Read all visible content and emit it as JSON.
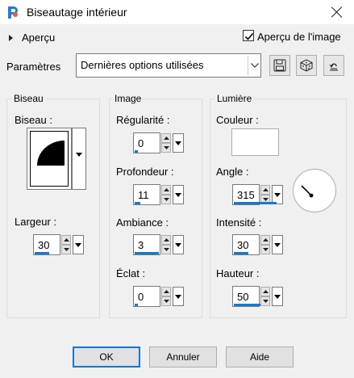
{
  "window": {
    "title": "Biseautage intérieur",
    "icon": "paintshop-pro-icon"
  },
  "preview": {
    "label": "Aperçu",
    "checkbox_label": "Aperçu de l'image",
    "checkbox_checked": true
  },
  "params": {
    "label": "Paramètres",
    "preset": "Dernières options utilisées",
    "buttons": [
      "save-preset-icon",
      "randomize-icon",
      "reset-icon"
    ]
  },
  "bevel": {
    "group_title": "Biseau",
    "bevel_label": "Biseau :",
    "width_label": "Largeur :",
    "width_value": "30"
  },
  "image": {
    "group_title": "Image",
    "smoothness_label": "Régularité :",
    "smoothness_value": "0",
    "depth_label": "Profondeur :",
    "depth_value": "11",
    "ambience_label": "Ambiance :",
    "ambience_value": "3",
    "shininess_label": "Éclat :",
    "shininess_value": "0"
  },
  "light": {
    "group_title": "Lumière",
    "color_label": "Couleur :",
    "color_value": "#ffffff",
    "angle_label": "Angle :",
    "angle_value": "315",
    "intensity_label": "Intensité :",
    "intensity_value": "30",
    "elevation_label": "Hauteur :",
    "elevation_value": "50"
  },
  "footer": {
    "ok": "OK",
    "cancel": "Annuler",
    "help": "Aide"
  },
  "colors": {
    "accent": "#0078d7",
    "slider": "#1979ca",
    "dialog_bg": "#f0f0f0"
  }
}
